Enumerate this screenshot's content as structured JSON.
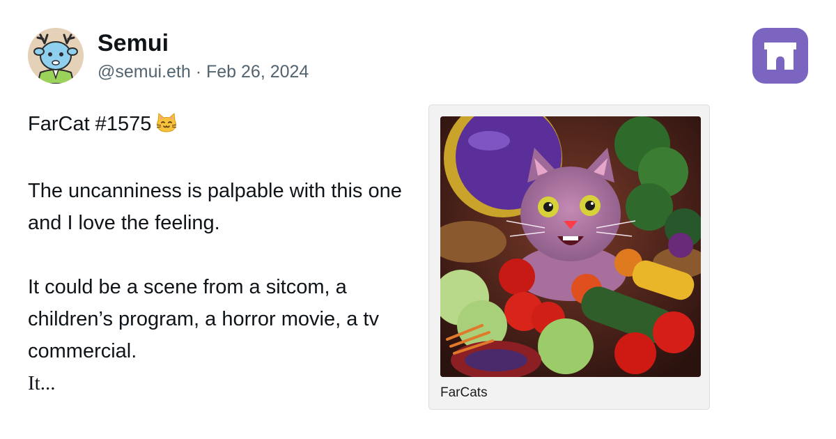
{
  "author": {
    "name": "Semui",
    "handle": "@semui.eth",
    "separator": " · ",
    "date": "Feb 26, 2024"
  },
  "brand": {
    "icon": "farcaster-arch-icon",
    "color": "#7c65c1"
  },
  "post": {
    "title": "FarCat #1575",
    "title_emoji": "cat-face-icon",
    "paragraph_1": "The uncanniness is palpable with this one and I love the feeling.",
    "paragraph_2": "It could be a scene from a sitcom, a children’s program, a horror movie, a tv commercial.",
    "truncated": "It..."
  },
  "embed": {
    "image": "farcat-image",
    "label": "FarCats"
  }
}
